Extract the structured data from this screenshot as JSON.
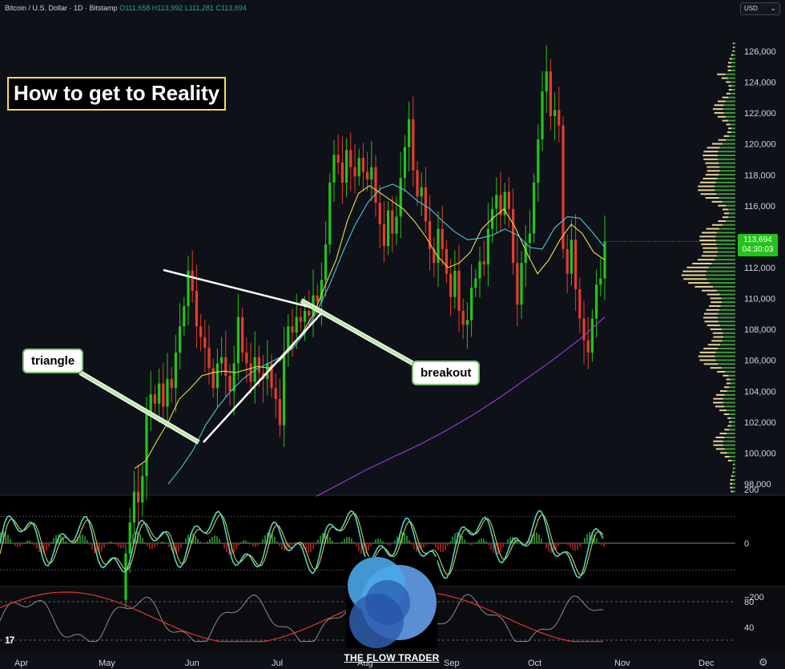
{
  "header": {
    "symbol": "Bitcoin / U.S. Dollar · 1D · Bitstamp",
    "open_label": "O",
    "open": "111,658",
    "high_label": "H",
    "high": "113,992",
    "low_label": "L",
    "low": "111,281",
    "close_label": "C",
    "close": "113,694"
  },
  "currency": "USD",
  "title": "How to get to Reality",
  "annotations": {
    "triangle": "triangle",
    "breakout": "breakout"
  },
  "price_tag": {
    "price": "113,694",
    "countdown": "04:30:03"
  },
  "logo": {
    "caption": "THE FLOW TRADER"
  },
  "colors": {
    "up": "#22c41a",
    "down": "#e63b2e",
    "ma_fast": "#e8e04a",
    "ma_mid": "#4fc3d9",
    "ma_slow": "#a236e8",
    "volume_profile_up": "#3e9a3a",
    "volume_profile_down": "#e6d396",
    "title_border": "#f4e04d",
    "label_border": "#7cc46f"
  },
  "chart_data": [
    {
      "type": "candlestick",
      "title": "Bitcoin / U.S. Dollar · 1D · Bitstamp",
      "x_ticks": [
        "Apr",
        "May",
        "Jun",
        "Jul",
        "Aug",
        "Sep",
        "Oct",
        "Nov",
        "Dec"
      ],
      "y_ticks": [
        "98,000",
        "100,000",
        "102,000",
        "104,000",
        "106,000",
        "108,000",
        "110,000",
        "112,000",
        "114,000",
        "116,000",
        "118,000",
        "120,000",
        "122,000",
        "124,000",
        "126,000"
      ],
      "ylim": [
        97000,
        127000
      ],
      "last_close": 113694,
      "series": [
        {
          "name": "close",
          "values": [
            93500,
            95500,
            97500,
            96800,
            98500,
            102500,
            103800,
            103200,
            104500,
            103000,
            104800,
            104200,
            106500,
            108200,
            109500,
            111800,
            110500,
            108200,
            107500,
            106800,
            105500,
            104200,
            105800,
            106200,
            105000,
            104000,
            105800,
            108800,
            106500,
            105800,
            104600,
            106200,
            105200,
            104800,
            105800,
            104200,
            103500,
            101800,
            106500,
            108200,
            107800,
            108800,
            108500,
            109200,
            108900,
            110200,
            109800,
            111200,
            113500,
            117500,
            119300,
            118800,
            117500,
            119600,
            118500,
            117900,
            119100,
            118200,
            117700,
            118500,
            116200,
            114800,
            113400,
            115700,
            114200,
            115300,
            117800,
            119800,
            121600,
            118300,
            116600,
            117200,
            115000,
            113200,
            112300,
            114500,
            113200,
            111600,
            110100,
            111800,
            109200,
            108300,
            108600,
            110700,
            111300,
            112400,
            112200,
            114500,
            115800,
            116700,
            115400,
            116900,
            115800,
            112300,
            109600,
            112300,
            113600,
            114200,
            117500,
            120300,
            123400,
            124700,
            121800,
            122200,
            121200,
            113200,
            111600,
            113800,
            110600,
            108700,
            107300,
            106500,
            108700,
            110900,
            111300,
            113694
          ]
        },
        {
          "name": "MA fast",
          "values": [
            99000,
            99500,
            100800,
            102000,
            103500,
            104200,
            105000,
            105200,
            105300,
            105200,
            105400,
            105600,
            105500,
            106000,
            106800,
            107800,
            109000,
            110800,
            112500,
            115000,
            116800,
            117300,
            116800,
            116300,
            115800,
            115000,
            114000,
            112800,
            112000,
            112300,
            113000,
            114500,
            115200,
            115800,
            114600,
            113000,
            111600,
            112500,
            113800,
            114800,
            114200,
            113000,
            112500
          ]
        },
        {
          "name": "MA mid",
          "values": [
            98000,
            99000,
            100200,
            101800,
            103000,
            104000,
            104800,
            105400,
            105800,
            106200,
            106800,
            107800,
            109300,
            111000,
            113000,
            114800,
            116200,
            117100,
            117400,
            117000,
            116300,
            115800,
            115000,
            114300,
            113800,
            113900,
            114100,
            114500,
            114100,
            113300,
            113200,
            114600,
            115300,
            115200,
            114300,
            113300
          ]
        },
        {
          "name": "MA slow",
          "values": [
            97200,
            98100,
            99000,
            99800,
            100600,
            101500,
            102500,
            103600,
            104800,
            106000,
            107300,
            108800
          ]
        }
      ]
    },
    {
      "type": "line",
      "name": "momentum oscillator",
      "y_ticks": [
        "200",
        "0",
        "−200"
      ],
      "ylim": [
        -300,
        300
      ]
    },
    {
      "type": "line",
      "name": "stochastic oscillator",
      "y_ticks": [
        "80",
        "40"
      ],
      "ylim": [
        0,
        100
      ]
    }
  ]
}
